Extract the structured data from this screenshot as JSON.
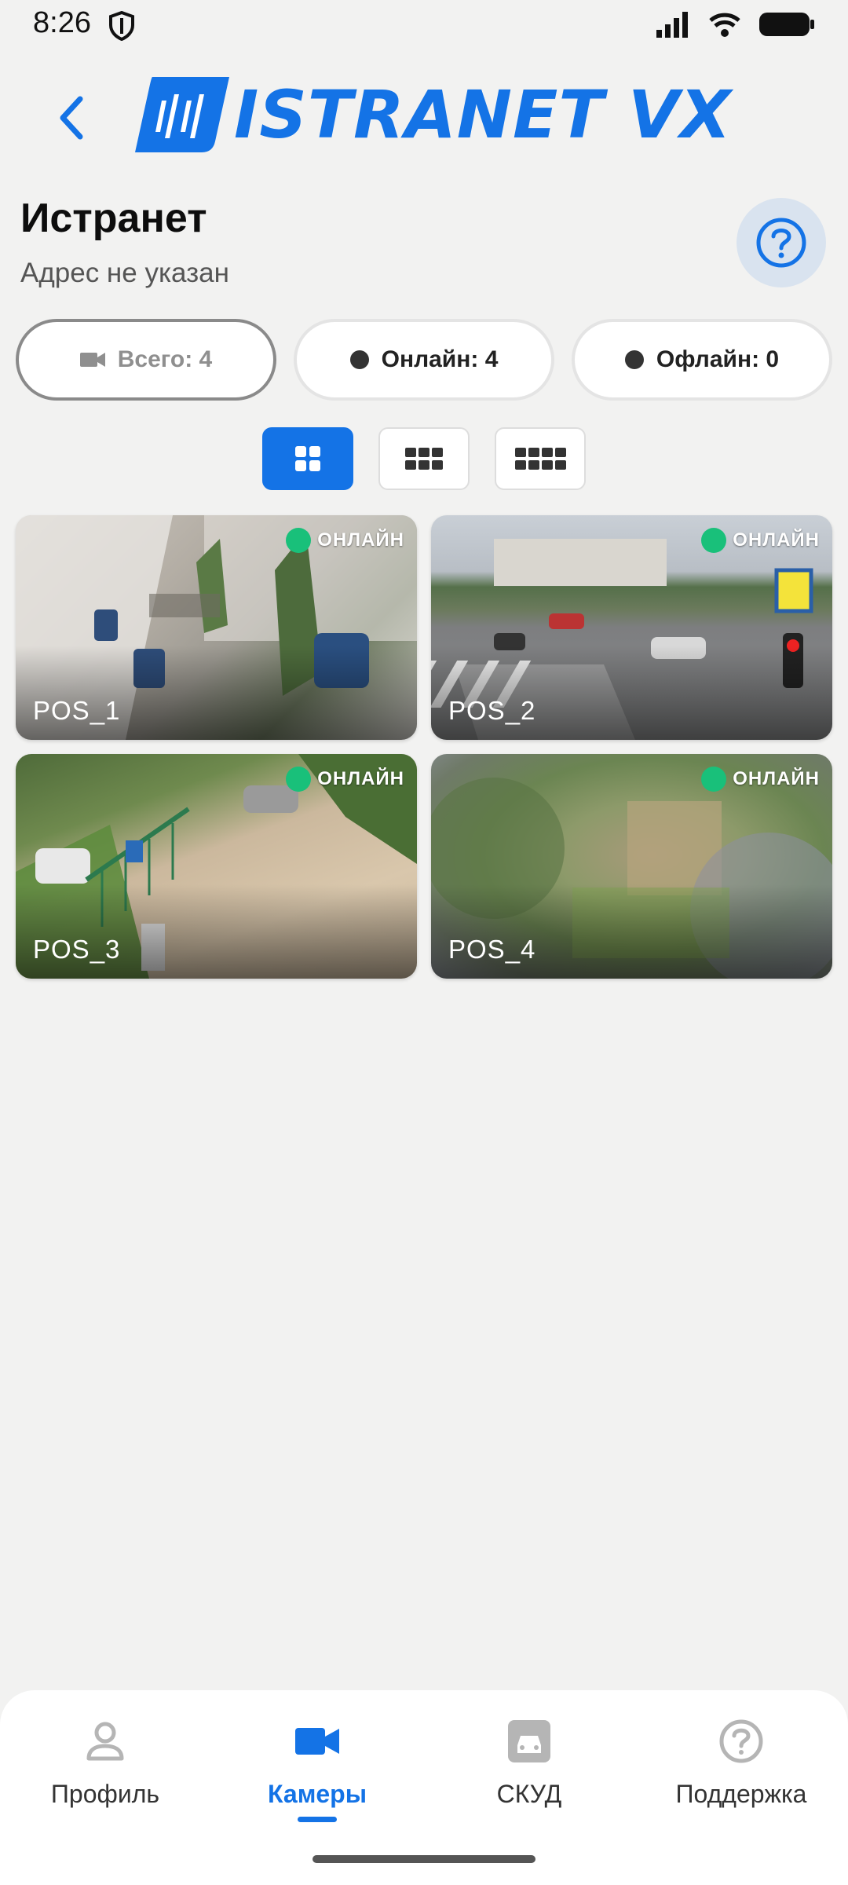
{
  "status_bar": {
    "time": "8:26"
  },
  "header": {
    "logo_text": "ISTRANET VX"
  },
  "site": {
    "title": "Истранет",
    "address": "Адрес не указан"
  },
  "filters": [
    {
      "label": "Всего: 4",
      "icon": "video-camera-icon",
      "active": true
    },
    {
      "label": "Онлайн: 4",
      "icon": "dot-icon",
      "active": false
    },
    {
      "label": "Офлайн: 0",
      "icon": "dot-icon",
      "active": false
    }
  ],
  "views": [
    {
      "name": "grid-2x2",
      "active": true
    },
    {
      "name": "grid-3x3",
      "active": false
    },
    {
      "name": "grid-4x4",
      "active": false
    }
  ],
  "cameras": [
    {
      "name": "POS_1",
      "status": "ОНЛАЙН"
    },
    {
      "name": "POS_2",
      "status": "ОНЛАЙН"
    },
    {
      "name": "POS_3",
      "status": "ОНЛАЙН"
    },
    {
      "name": "POS_4",
      "status": "ОНЛАЙН"
    }
  ],
  "bottom_nav": [
    {
      "label": "Профиль",
      "icon": "person-icon",
      "active": false
    },
    {
      "label": "Камеры",
      "icon": "video-camera-icon",
      "active": true
    },
    {
      "label": "СКУД",
      "icon": "car-icon",
      "active": false
    },
    {
      "label": "Поддержка",
      "icon": "help-circle-icon",
      "active": false
    }
  ],
  "colors": {
    "accent": "#1473e6",
    "online": "#19c07a",
    "background": "#f2f2f1"
  }
}
